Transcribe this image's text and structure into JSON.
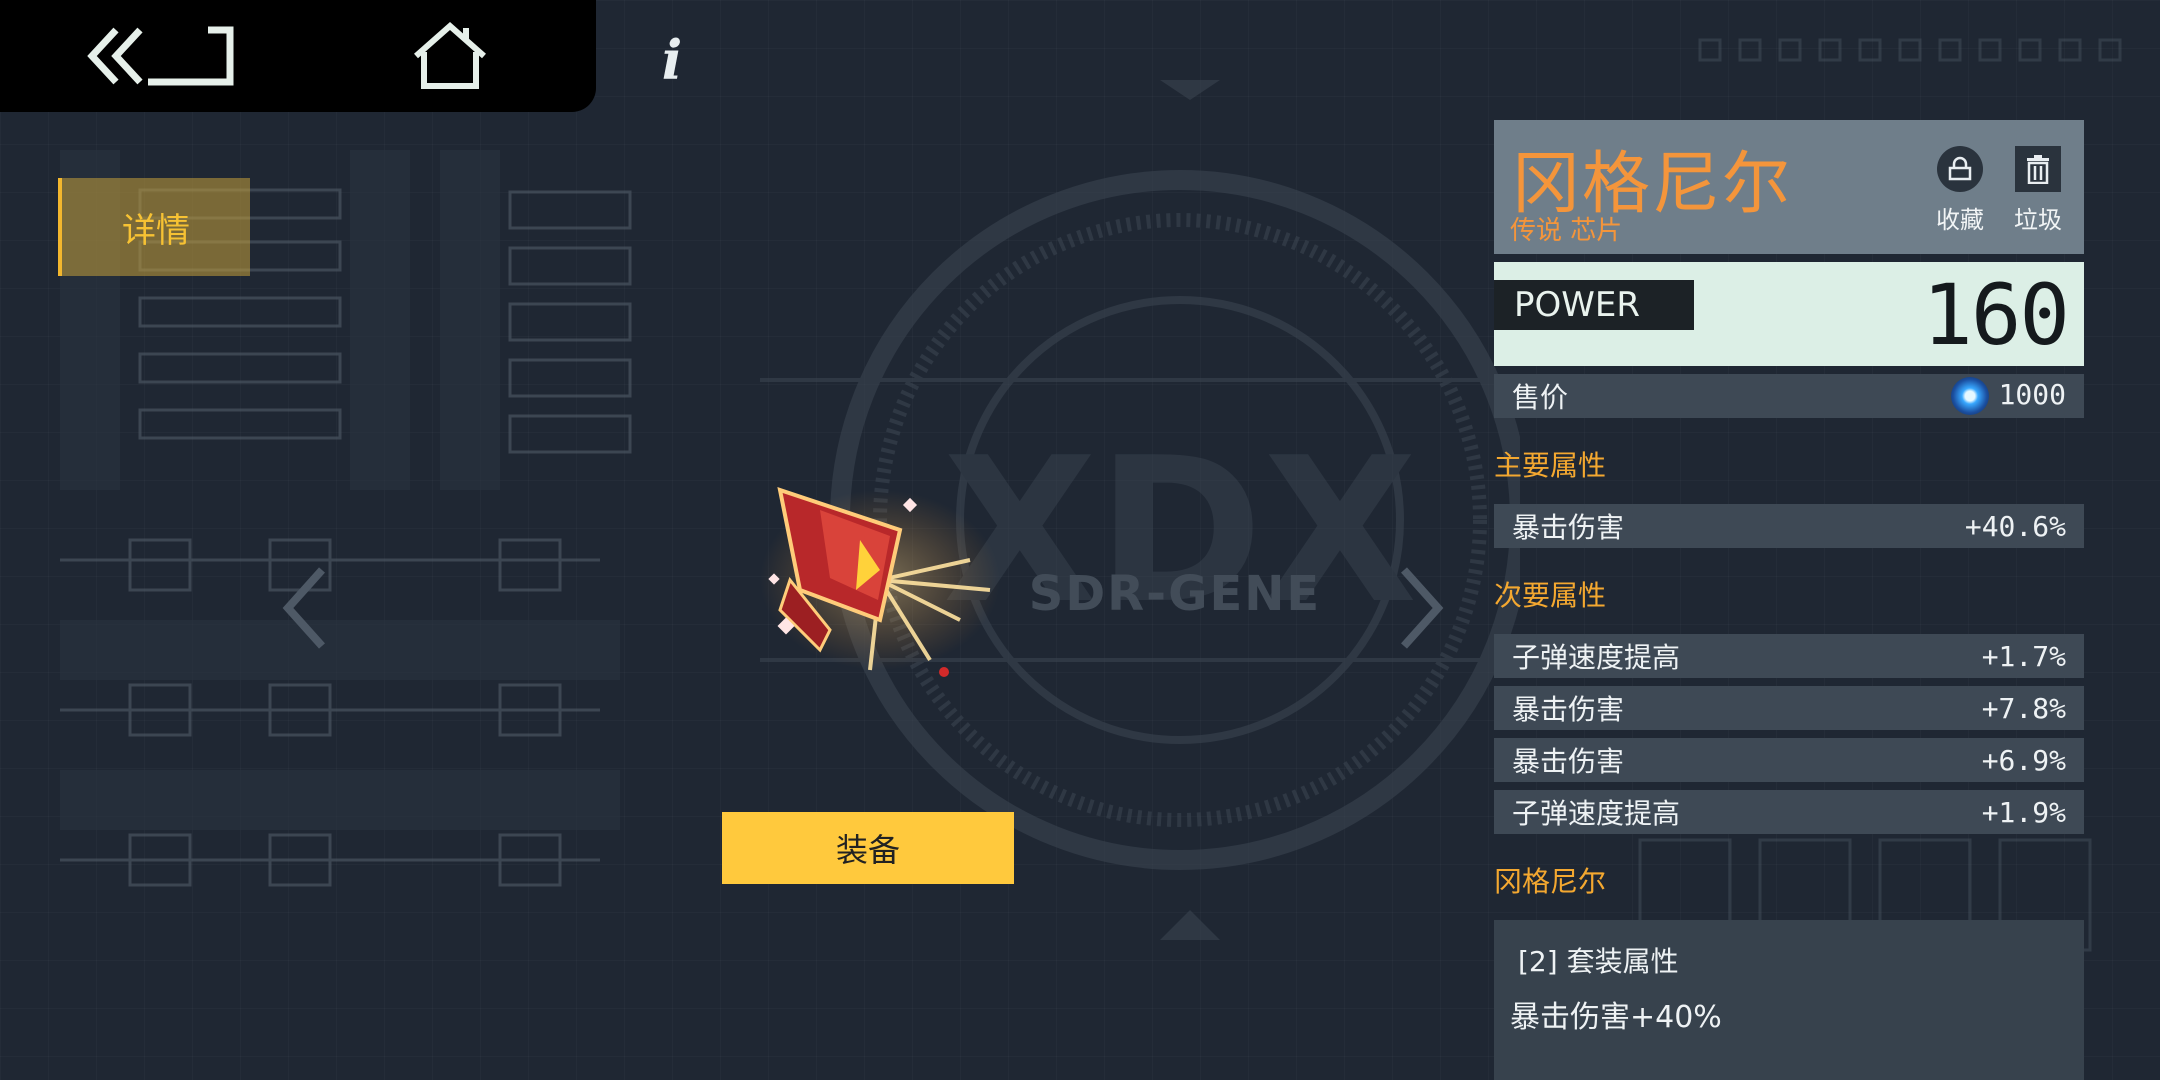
{
  "nav": {
    "back_icon": "double-chevron-left-icon",
    "home_icon": "home-icon",
    "info_label": "i"
  },
  "tabs": {
    "detail_label": "详情"
  },
  "emblem": {
    "text": "SDR-GENE"
  },
  "equip_button": {
    "label": "装备"
  },
  "item": {
    "name": "冈格尼尔",
    "rarity": "传说 芯片",
    "actions": {
      "collect_label": "收藏",
      "trash_label": "垃圾"
    },
    "power": {
      "label": "POWER",
      "value": "160"
    },
    "price": {
      "label": "售价",
      "value": "1000",
      "currency_icon": "blue-orb-currency-icon"
    },
    "main_attributes": {
      "title": "主要属性",
      "rows": [
        {
          "name": "暴击伤害",
          "value": "+40.6%"
        }
      ]
    },
    "sub_attributes": {
      "title": "次要属性",
      "rows": [
        {
          "name": "子弹速度提高",
          "value": "+1.7%"
        },
        {
          "name": "暴击伤害",
          "value": "+7.8%"
        },
        {
          "name": "暴击伤害",
          "value": "+6.9%"
        },
        {
          "name": "子弹速度提高",
          "value": "+1.9%"
        }
      ]
    },
    "set": {
      "title": "冈格尼尔",
      "bonus_title": "[2] 套装属性",
      "bonus_desc": "暴击伤害+40%"
    }
  },
  "colors": {
    "accent_orange": "#f4953b",
    "accent_yellow": "#ffc93d",
    "power_bg": "#dcefe6",
    "background": "#1f2733"
  }
}
